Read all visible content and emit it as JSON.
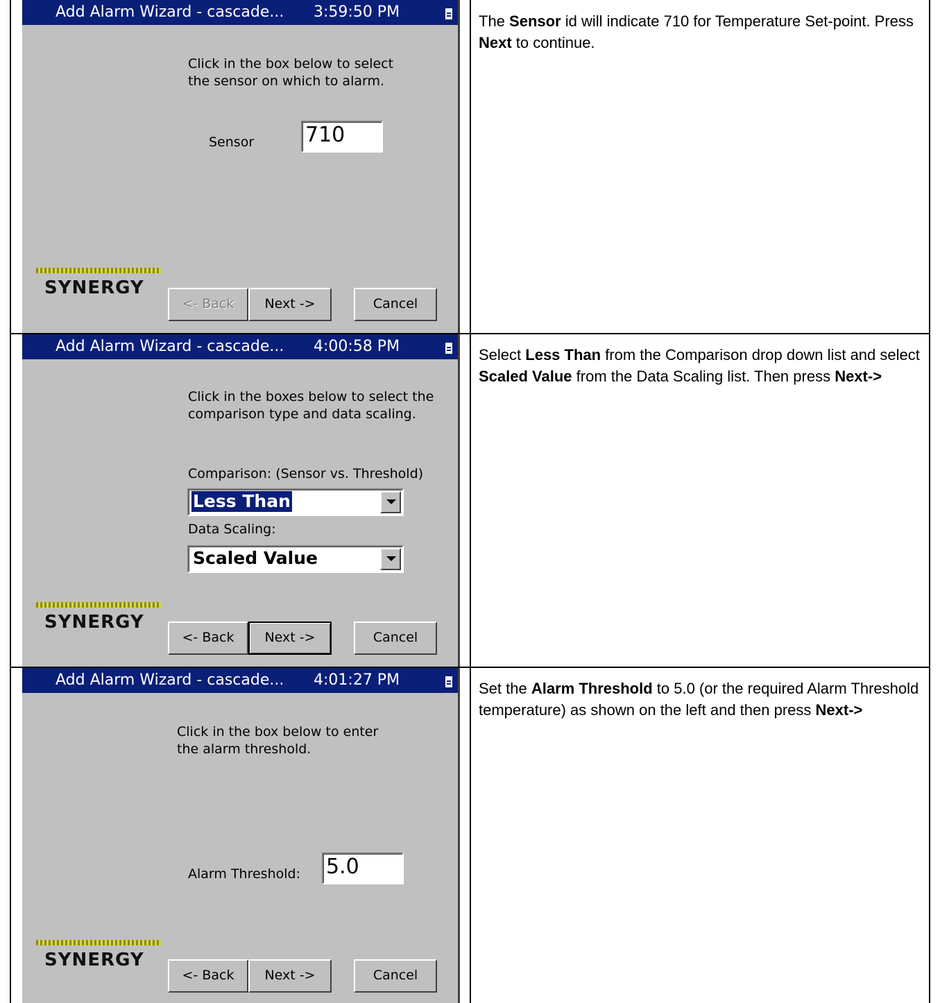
{
  "panels": [
    {
      "window_title": "Add Alarm Wizard - cascade...",
      "time": "3:59:50 PM",
      "instruction": "Click in the box below to select\nthe sensor on which to alarm.",
      "field_label": "Sensor",
      "field_value": "710",
      "logo_text": "SYNERGY",
      "buttons": {
        "back": "<- Back",
        "next": "Next ->",
        "cancel": "Cancel"
      },
      "description": {
        "p1": "The ",
        "b1": "Sensor",
        "p2": " id will indicate 710 for Temperature Set-point. Press ",
        "b2": "Next",
        "p3": " to continue."
      }
    },
    {
      "window_title": "Add Alarm Wizard - cascade...",
      "time": "4:00:58 PM",
      "instruction": "Click in the boxes below to select the\ncomparison type and data scaling.",
      "comparison_label": "Comparison:   (Sensor vs. Threshold)",
      "comparison_value": "Less Than",
      "scaling_label": "Data Scaling:",
      "scaling_value": "Scaled Value",
      "logo_text": "SYNERGY",
      "buttons": {
        "back": "<- Back",
        "next": "Next ->",
        "cancel": "Cancel"
      },
      "description": {
        "p1": "Select ",
        "b1": "Less Than",
        "p2": " from the Comparison drop down list and select ",
        "b2": "Scaled Value",
        "p3": " from the Data Scaling list. Then press ",
        "b3": "Next->"
      }
    },
    {
      "window_title": "Add Alarm Wizard - cascade...",
      "time": "4:01:27 PM",
      "instruction": "Click in the box below to enter\nthe alarm threshold.",
      "field_label": "Alarm Threshold:",
      "field_value": "5.0",
      "logo_text": "SYNERGY",
      "buttons": {
        "back": "<- Back",
        "next": "Next ->",
        "cancel": "Cancel"
      },
      "description": {
        "p1": "Set the ",
        "b1": "Alarm Threshold",
        "p2": " to 5.0 (or the required Alarm Threshold temperature) as shown on the left and then press ",
        "b2": "Next->"
      }
    }
  ],
  "colors": {
    "titlebar": "#0a1f78",
    "panel_bg": "#c0c0c0"
  }
}
